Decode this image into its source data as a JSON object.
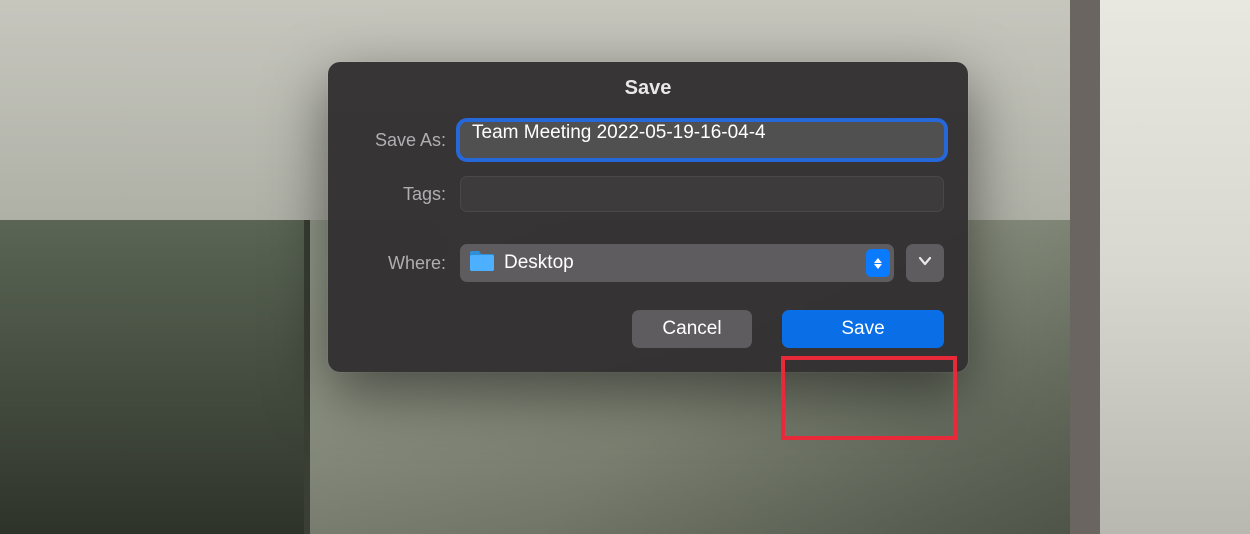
{
  "dialog": {
    "title": "Save",
    "save_as_label": "Save As:",
    "save_as_value": "Team Meeting 2022-05-19-16-04-4",
    "tags_label": "Tags:",
    "tags_value": "",
    "where_label": "Where:",
    "where_value": "Desktop",
    "cancel_label": "Cancel",
    "save_label": "Save"
  }
}
